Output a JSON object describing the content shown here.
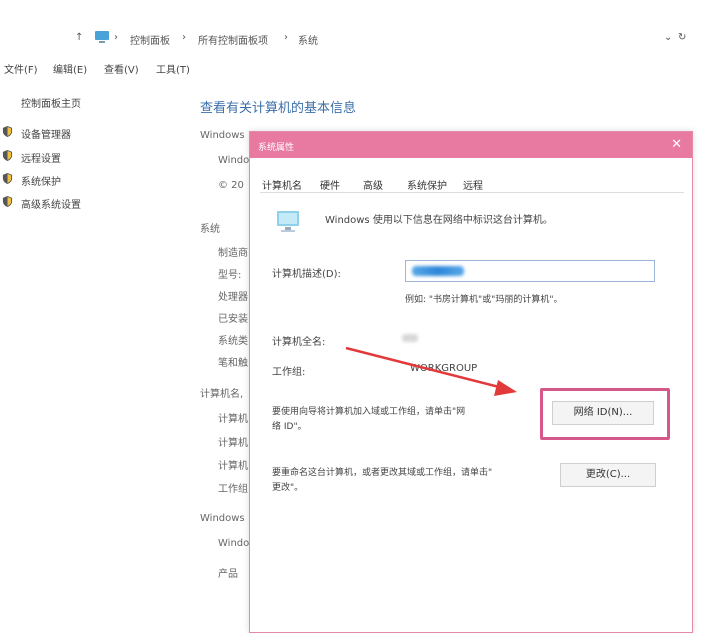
{
  "address_bar": {
    "up_arrow": "↑",
    "sep": "›",
    "crumbs": [
      "控制面板",
      "所有控制面板项",
      "系统"
    ],
    "dropdown": "⌄",
    "refresh": "↻"
  },
  "menu": {
    "items": [
      "文件(F)",
      "编辑(E)",
      "查看(V)",
      "工具(T)"
    ]
  },
  "left_panel": {
    "home": "控制面板主页",
    "links": [
      "设备管理器",
      "远程设置",
      "系统保护",
      "高级系统设置"
    ]
  },
  "main": {
    "title": "查看有关计算机的基本信息",
    "windows_section": "Windows",
    "windows_line": "Windo",
    "id_line": "© 20",
    "system_section": "系统",
    "system_rows": [
      "制造商",
      "型号:",
      "处理器",
      "已安装",
      "系统类",
      "笔和触"
    ],
    "computer_section": "计算机名,",
    "computer_rows": [
      "计算机",
      "计算机",
      "计算机",
      "工作组"
    ],
    "activation_section": "Windows",
    "activation_rows": [
      "Windo",
      "产品"
    ]
  },
  "dialog": {
    "title": "系统属性",
    "close": "✕",
    "tabs": [
      "计算机名",
      "硬件",
      "高级",
      "系统保护",
      "远程"
    ],
    "intro": "Windows 使用以下信息在网络中标识这台计算机。",
    "description_label": "计算机描述(D):",
    "description_hint": "例如: \"书房计算机\"或\"玛丽的计算机\"。",
    "full_name_label": "计算机全名:",
    "workgroup_label": "工作组:",
    "workgroup_value": "WORKGROUP",
    "network_text_1": "要使用向导将计算机加入域或工作组，请单击\"网",
    "network_text_2": "络 ID\"。",
    "network_button": "网络 ID(N)...",
    "rename_text_1": "要重命名这台计算机，或者更改其域或工作组，请单击\"",
    "rename_text_2": "更改\"。",
    "change_button": "更改(C)..."
  },
  "colors": {
    "dialog_titlebar": "#e879a0",
    "highlight": "#d5588a",
    "arrow": "#e23a3a",
    "title_blue": "#3b6fa8"
  }
}
